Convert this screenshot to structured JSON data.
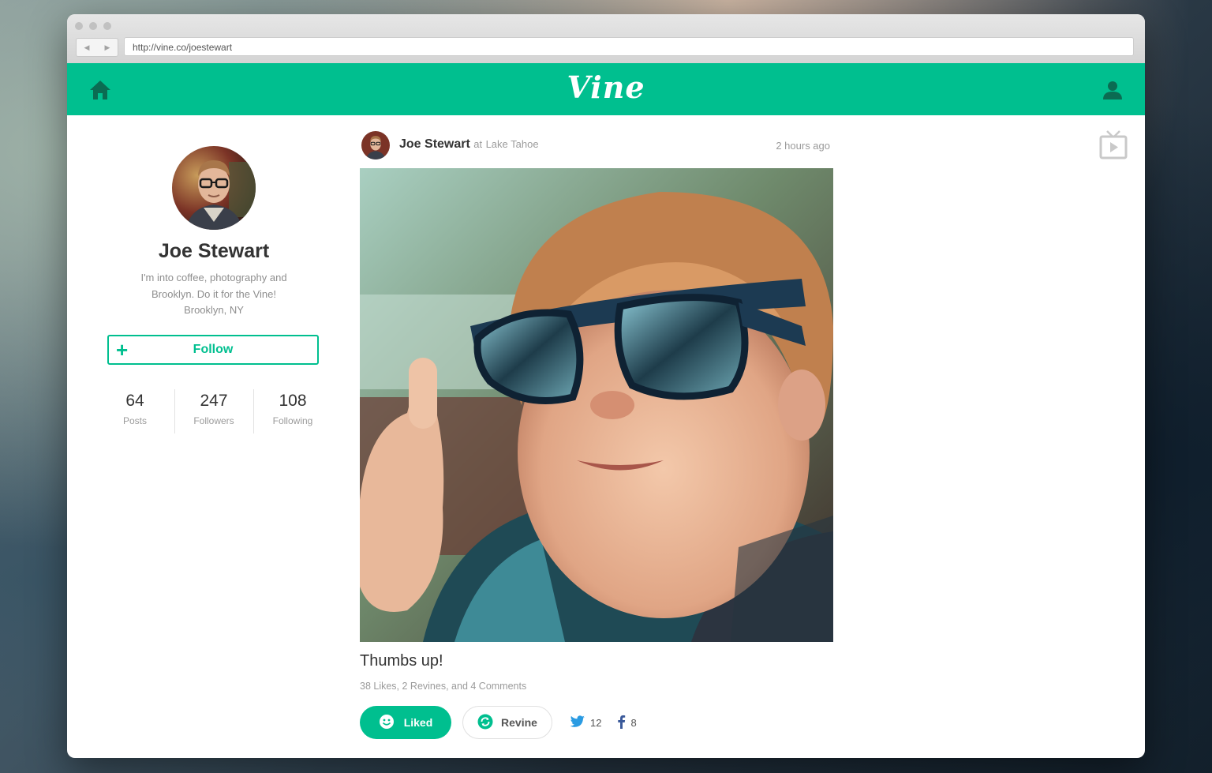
{
  "browser": {
    "url": "http://vine.co/joestewart",
    "back_glyph": "◀",
    "forward_glyph": "▶"
  },
  "header": {
    "logo": "Vine",
    "left_icon": "home-icon",
    "right_icon": "user-icon",
    "brand_color": "#00bf8f"
  },
  "profile": {
    "name": "Joe Stewart",
    "bio_lines": [
      "I'm into coffee, photography and",
      "Brooklyn. Do it for the Vine!",
      "Brooklyn, NY"
    ],
    "follow_label": "Follow",
    "follow_icon_glyph": "+",
    "stats": [
      {
        "value": "64",
        "label": "Posts"
      },
      {
        "value": "247",
        "label": "Followers"
      },
      {
        "value": "108",
        "label": "Following"
      }
    ]
  },
  "post": {
    "author": "Joe Stewart",
    "location_prefix": "at",
    "location": "Lake Tahoe",
    "time": "2 hours ago",
    "caption": "Thumbs up!",
    "counts": "38 Likes, 2 Revines, and 4 Comments",
    "liked_label": "Liked",
    "revine_label": "Revine",
    "twitter_count": "12",
    "facebook_count": "8"
  },
  "side": {
    "tv_icon": "tv-icon"
  }
}
